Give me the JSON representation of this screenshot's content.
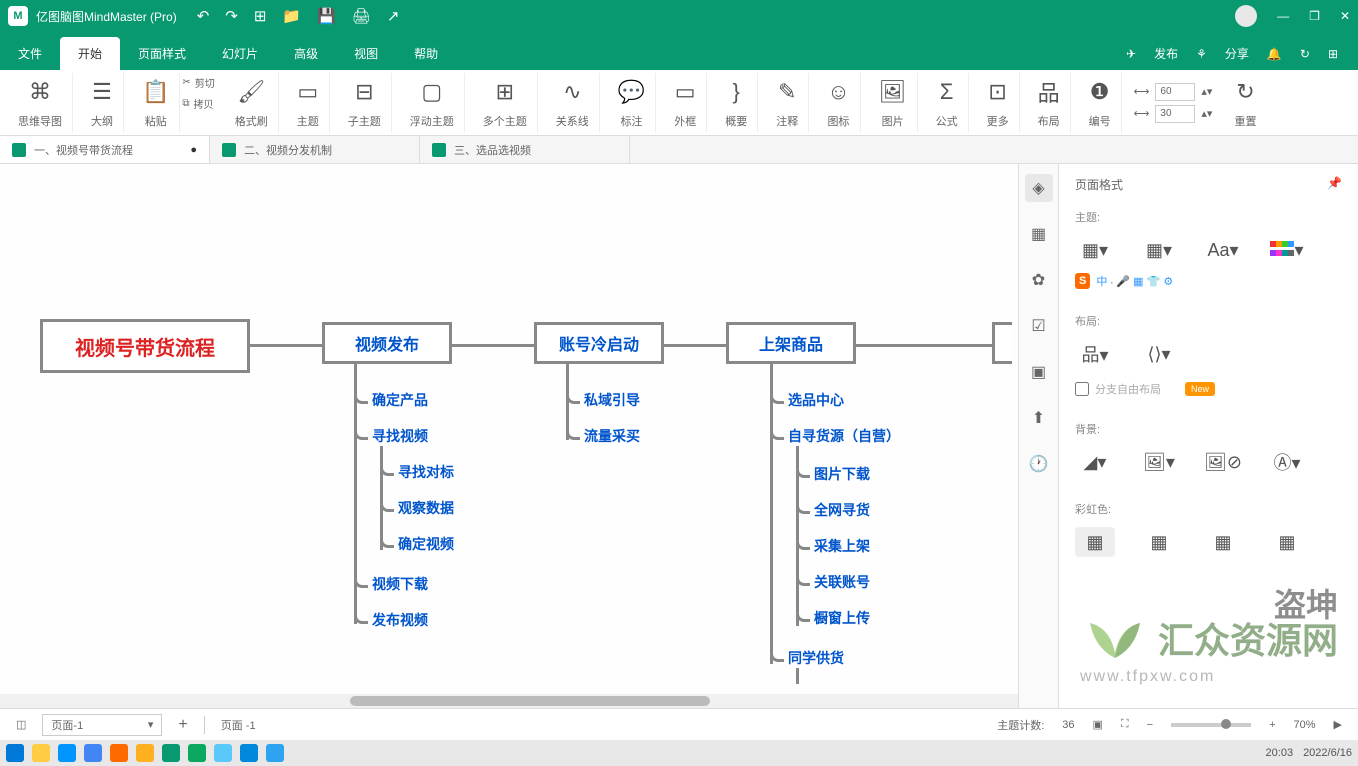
{
  "app": {
    "title": "亿图脑图MindMaster (Pro)"
  },
  "menu": {
    "file": "文件",
    "start": "开始",
    "pagestyle": "页面样式",
    "slide": "幻灯片",
    "advanced": "高级",
    "view": "视图",
    "help": "帮助",
    "publish": "发布",
    "share": "分享"
  },
  "ribbon": {
    "mindmap": "思维导图",
    "outline": "大纲",
    "paste": "粘贴",
    "cut": "剪切",
    "copy": "拷贝",
    "formatbrush": "格式刷",
    "topic": "主题",
    "subtopic": "子主题",
    "floating": "浮动主题",
    "multiple": "多个主题",
    "relation": "关系线",
    "callout": "标注",
    "boundary": "外框",
    "summary": "概要",
    "comment": "注释",
    "icon": "图标",
    "image": "图片",
    "formula": "公式",
    "more": "更多",
    "layout": "布局",
    "number": "编号",
    "reset": "重置",
    "spin1": "60",
    "spin2": "30"
  },
  "tabs": {
    "t1": "一、视频号带货流程",
    "t2": "二、视频分发机制",
    "t3": "三、选品选视频"
  },
  "sidepanel": {
    "header": "页面格式",
    "theme": "主题:",
    "layout": "布局:",
    "freebranch": "分支自由布局",
    "new": "New",
    "background": "背景:",
    "rainbow": "彩虹色:"
  },
  "mindmap": {
    "root": "视频号带货流程",
    "n1": "视频发布",
    "n2": "账号冷启动",
    "n3": "上架商品",
    "s1_1": "确定产品",
    "s1_2": "寻找视频",
    "s1_2_1": "寻找对标",
    "s1_2_2": "观察数据",
    "s1_2_3": "确定视频",
    "s1_3": "视频下载",
    "s1_4": "发布视频",
    "s2_1": "私域引导",
    "s2_2": "流量采买",
    "s3_1": "选品中心",
    "s3_2": "自寻货源（自营）",
    "s3_2_1": "图片下载",
    "s3_2_2": "全网寻货",
    "s3_2_3": "采集上架",
    "s3_2_4": "关联账号",
    "s3_2_5": "橱窗上传",
    "s3_3": "同学供货"
  },
  "status": {
    "page": "页面-1",
    "pageLabel": "页面 -1",
    "topiccount": "主题计数:",
    "count": "36",
    "zoom": "70%"
  },
  "taskbar": {
    "time": "20:03",
    "date": "2022/6/16"
  },
  "watermark": {
    "text": "汇众资源网",
    "url": "www.tfpxw.com",
    "extra": "盗坤"
  }
}
